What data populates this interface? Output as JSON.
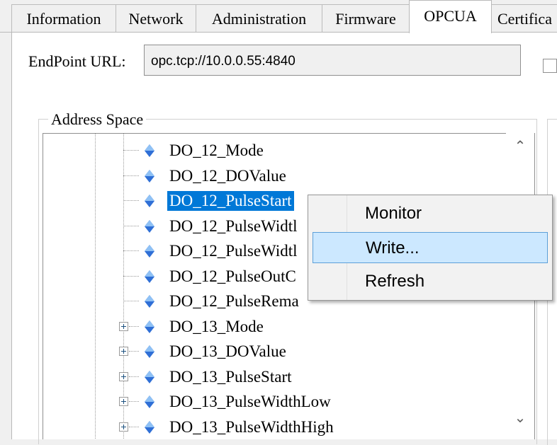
{
  "tabs": [
    {
      "label": "Information"
    },
    {
      "label": "Network"
    },
    {
      "label": "Administration"
    },
    {
      "label": "Firmware"
    },
    {
      "label": "OPCUA"
    },
    {
      "label": "Certifica"
    }
  ],
  "endpoint": {
    "label": "EndPoint URL:",
    "value": "opc.tcp://10.0.0.55:4840"
  },
  "address_space": {
    "title": "Address Space",
    "nodes": [
      {
        "label": "DO_12_Mode"
      },
      {
        "label": "DO_12_DOValue"
      },
      {
        "label": "DO_12_PulseStart"
      },
      {
        "label": "DO_12_PulseWidtl"
      },
      {
        "label": "DO_12_PulseWidtl"
      },
      {
        "label": "DO_12_PulseOutC"
      },
      {
        "label": "DO_12_PulseRema"
      },
      {
        "label": "DO_13_Mode"
      },
      {
        "label": "DO_13_DOValue"
      },
      {
        "label": "DO_13_PulseStart"
      },
      {
        "label": "DO_13_PulseWidthLow"
      },
      {
        "label": "DO_13_PulseWidthHigh"
      }
    ]
  },
  "context_menu": {
    "items": [
      {
        "label": "Monitor"
      },
      {
        "label": "Write..."
      },
      {
        "label": "Refresh"
      }
    ]
  },
  "colors": {
    "selection": "#0078d7",
    "menu_highlight": "#cce8ff"
  },
  "icons": {
    "node": "variable-node-icon",
    "expand": "plus-expand-icon",
    "scroll_up": "chevron-up-icon",
    "scroll_down": "chevron-down-icon"
  }
}
